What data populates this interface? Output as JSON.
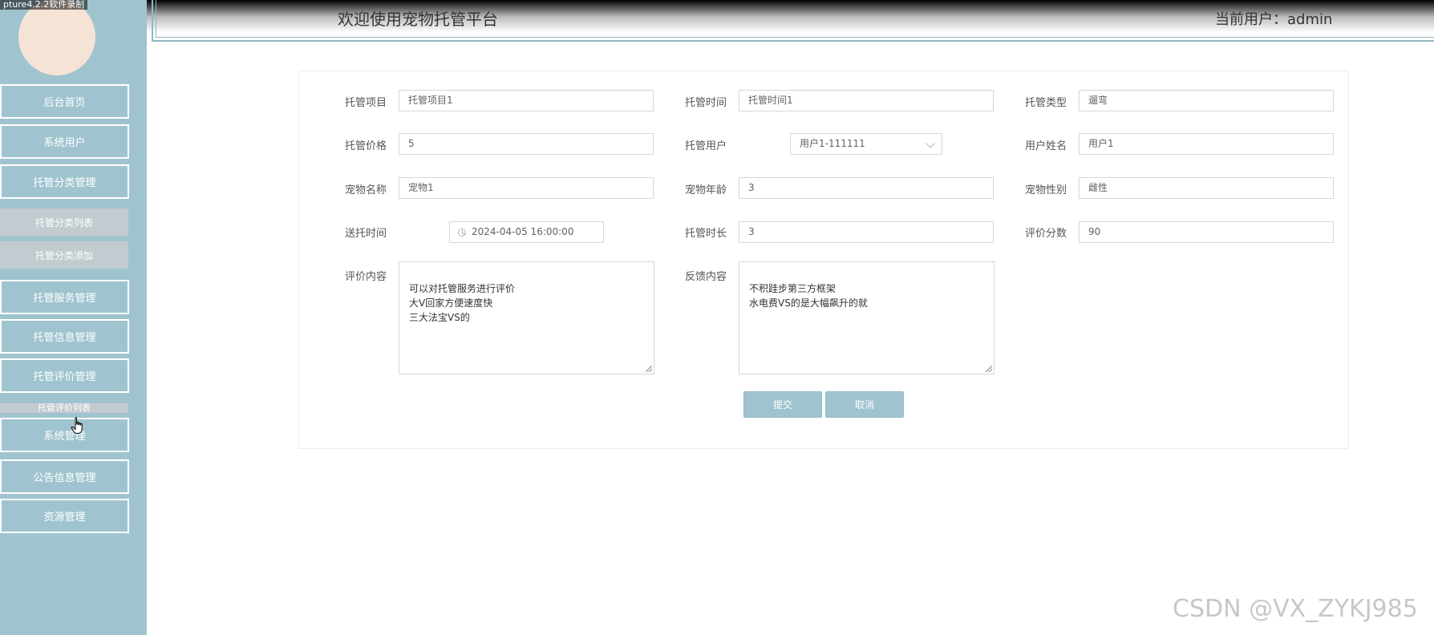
{
  "recorder_watermark": "pture4.2.2软件录制",
  "header": {
    "title": "欢迎使用宠物托管平台",
    "current_user": "当前用户：admin"
  },
  "sidebar": {
    "items": [
      {
        "label": "后台首页"
      },
      {
        "label": "系统用户"
      },
      {
        "label": "托管分类管理"
      },
      {
        "label": "托管分类列表"
      },
      {
        "label": "托管分类添加"
      },
      {
        "label": "托管服务管理"
      },
      {
        "label": "托管信息管理"
      },
      {
        "label": "托管评价管理"
      },
      {
        "label": "托管评价列表"
      },
      {
        "label": "系统管理"
      },
      {
        "label": "公告信息管理"
      },
      {
        "label": "资源管理"
      }
    ]
  },
  "form": {
    "row1": {
      "item_label": "托管项目",
      "item_value": "托管项目1",
      "time_label": "托管时间",
      "time_value": "托管时间1",
      "type_label": "托管类型",
      "type_value": "遛弯"
    },
    "row2": {
      "price_label": "托管价格",
      "price_value": "5",
      "user_label": "托管用户",
      "user_value": "用户1-111111",
      "name_label": "用户姓名",
      "name_value": "用户1"
    },
    "row3": {
      "pet_name_label": "宠物名称",
      "pet_name_value": "宠物1",
      "pet_age_label": "宠物年龄",
      "pet_age_value": "3",
      "pet_sex_label": "宠物性别",
      "pet_sex_value": "雌性"
    },
    "row4": {
      "send_time_label": "送托时间",
      "send_time_value": "2024-04-05 16:00:00",
      "duration_label": "托管时长",
      "duration_value": "3",
      "score_label": "评价分数",
      "score_value": "90"
    },
    "row5": {
      "review_label": "评价内容",
      "review_value": "可以对托管服务进行评价\n大V回家方便速度快\n三大法宝VS的",
      "feedback_label": "反馈内容",
      "feedback_value": "不积跬步第三方框架\n水电费VS的是大幅飙升的就"
    },
    "submit_label": "提交",
    "cancel_label": "取消"
  },
  "csdn_watermark": "CSDN @VX_ZYKJ985"
}
